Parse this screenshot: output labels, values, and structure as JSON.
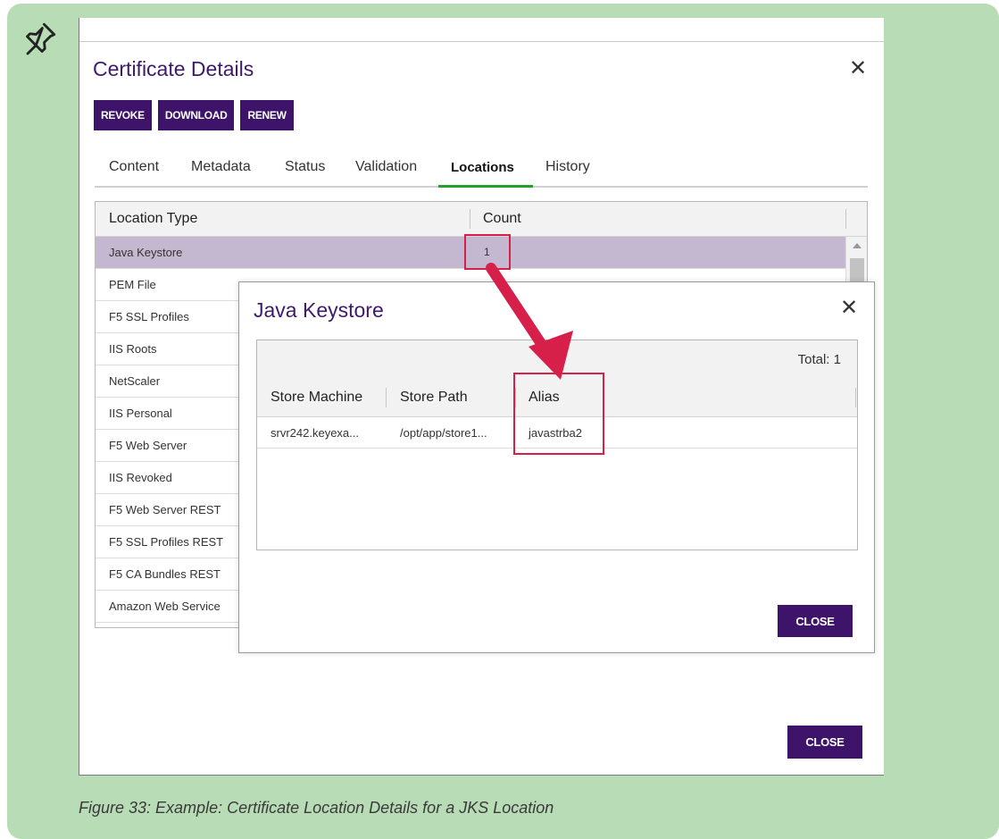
{
  "certificate_dialog": {
    "title": "Certificate Details",
    "actions": {
      "revoke": "REVOKE",
      "download": "DOWNLOAD",
      "renew": "RENEW"
    },
    "tabs": [
      "Content",
      "Metadata",
      "Status",
      "Validation",
      "Locations",
      "History"
    ],
    "active_tab": "Locations",
    "grid": {
      "columns": [
        "Location Type",
        "Count"
      ],
      "rows": [
        {
          "type": "Java Keystore",
          "count": "1"
        },
        {
          "type": "PEM File",
          "count": ""
        },
        {
          "type": "F5 SSL Profiles",
          "count": ""
        },
        {
          "type": "IIS Roots",
          "count": ""
        },
        {
          "type": "NetScaler",
          "count": ""
        },
        {
          "type": "IIS Personal",
          "count": ""
        },
        {
          "type": "F5 Web Server",
          "count": ""
        },
        {
          "type": "IIS Revoked",
          "count": ""
        },
        {
          "type": "F5 Web Server REST",
          "count": ""
        },
        {
          "type": "F5 SSL Profiles REST",
          "count": ""
        },
        {
          "type": "F5 CA Bundles REST",
          "count": ""
        },
        {
          "type": "Amazon Web Service",
          "count": ""
        }
      ]
    },
    "close_label": "CLOSE"
  },
  "keystore_modal": {
    "title": "Java Keystore",
    "total": "Total: 1",
    "columns": [
      "Store Machine",
      "Store Path",
      "Alias"
    ],
    "rows": [
      {
        "store_machine": "srvr242.keyexa...",
        "store_path": "/opt/app/store1...",
        "alias": "javastrba2"
      }
    ],
    "close_label": "CLOSE"
  },
  "caption": "Figure 33: Example: Certificate Location Details for a JKS Location",
  "colors": {
    "brand_purple": "#3d1469",
    "title_purple": "#3e1a6e",
    "selected_row": "#c3b8cf",
    "active_tab_underline": "#22a22a",
    "highlight_red": "#d6204a",
    "callout_green": "#b8dcb6"
  },
  "icons": {
    "pin": "pin-icon",
    "close": "close-icon",
    "arrow": "arrow-annotation"
  }
}
